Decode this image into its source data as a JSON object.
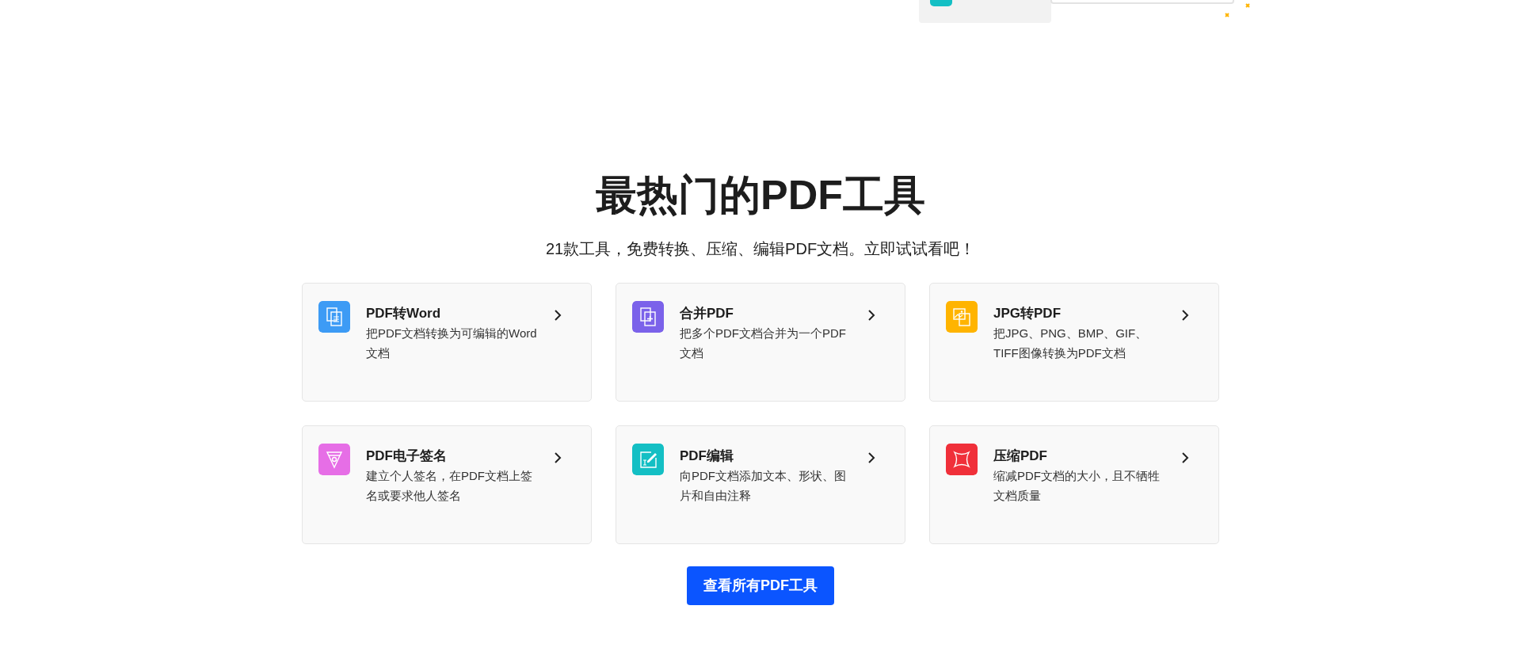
{
  "heading": "最热门的PDF工具",
  "subtitle": "21款工具，免费转换、压缩、编辑PDF文档。立即试试看吧！",
  "tools": [
    {
      "title": "PDF转Word",
      "description": "把PDF文档转换为可编辑的Word文档",
      "color": "#3d9bf5",
      "kind": "document"
    },
    {
      "title": "合并PDF",
      "description": "把多个PDF文档合并为一个PDF文档",
      "color": "#7b62ea",
      "kind": "merge"
    },
    {
      "title": "JPG转PDF",
      "description": "把JPG、PNG、BMP、GIF、TIFF图像转换为PDF文档",
      "color": "#ffb400",
      "kind": "image"
    },
    {
      "title": "PDF电子签名",
      "description": "建立个人签名，在PDF文档上签名或要求他人签名",
      "color": "#e66ee6",
      "kind": "pen"
    },
    {
      "title": "PDF编辑",
      "description": "向PDF文档添加文本、形状、图片和自由注释",
      "color": "#14bfc4",
      "kind": "edit"
    },
    {
      "title": "压缩PDF",
      "description": "缩减PDF文档的大小，且不牺牲文档质量",
      "color": "#f0303a",
      "kind": "compress"
    }
  ],
  "button": "查看所有PDF工具"
}
